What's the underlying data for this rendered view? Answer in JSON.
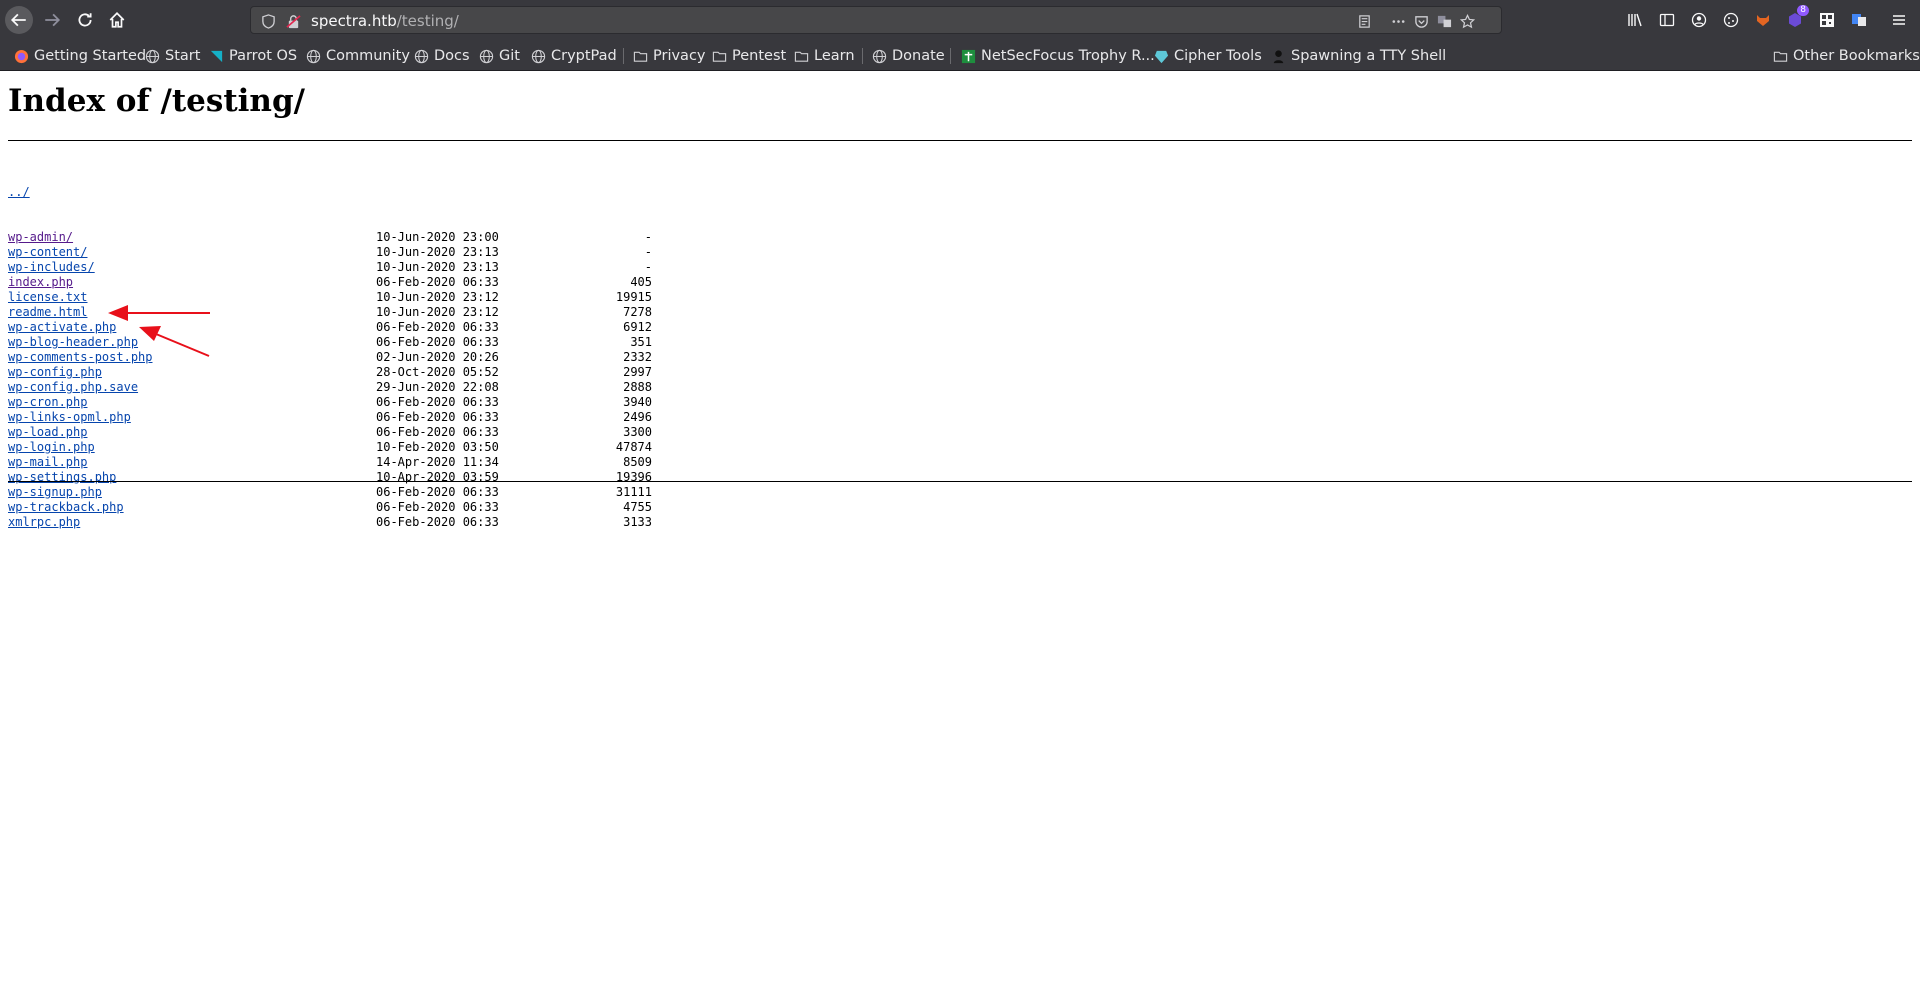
{
  "browser": {
    "url_host": "spectra.htb",
    "url_path": "/testing/",
    "bookmarks": [
      {
        "label": "Getting Started",
        "icon": "firefox-icon"
      },
      {
        "label": "Start",
        "icon": "globe-icon"
      },
      {
        "label": "Parrot OS",
        "icon": "parrot-icon"
      },
      {
        "label": "Community",
        "icon": "globe-icon"
      },
      {
        "label": "Docs",
        "icon": "globe-icon"
      },
      {
        "label": "Git",
        "icon": "globe-icon"
      },
      {
        "label": "CryptPad",
        "icon": "globe-icon"
      },
      {
        "label": "Privacy",
        "icon": "folder-icon"
      },
      {
        "label": "Pentest",
        "icon": "folder-icon"
      },
      {
        "label": "Learn",
        "icon": "folder-icon"
      },
      {
        "label": "Donate",
        "icon": "globe-icon"
      },
      {
        "label": "NetSecFocus Trophy R...",
        "icon": "netsec-icon"
      },
      {
        "label": "Cipher Tools",
        "icon": "cipher-icon"
      },
      {
        "label": "Spawning a TTY Shell",
        "icon": "shell-icon"
      }
    ],
    "other_bookmarks": "Other Bookmarks",
    "extension_badge": "8"
  },
  "page": {
    "title": "Index of /testing/",
    "parent_link": "../",
    "entries": [
      {
        "name": "wp-admin/",
        "date": "10-Jun-2020 23:00",
        "size": "-",
        "visited": true
      },
      {
        "name": "wp-content/",
        "date": "10-Jun-2020 23:13",
        "size": "-",
        "visited": false
      },
      {
        "name": "wp-includes/",
        "date": "10-Jun-2020 23:13",
        "size": "-",
        "visited": false
      },
      {
        "name": "index.php",
        "date": "06-Feb-2020 06:33",
        "size": "405",
        "visited": true
      },
      {
        "name": "license.txt",
        "date": "10-Jun-2020 23:12",
        "size": "19915",
        "visited": false
      },
      {
        "name": "readme.html",
        "date": "10-Jun-2020 23:12",
        "size": "7278",
        "visited": false
      },
      {
        "name": "wp-activate.php",
        "date": "06-Feb-2020 06:33",
        "size": "6912",
        "visited": false
      },
      {
        "name": "wp-blog-header.php",
        "date": "06-Feb-2020 06:33",
        "size": "351",
        "visited": false
      },
      {
        "name": "wp-comments-post.php",
        "date": "02-Jun-2020 20:26",
        "size": "2332",
        "visited": false
      },
      {
        "name": "wp-config.php",
        "date": "28-Oct-2020 05:52",
        "size": "2997",
        "visited": false
      },
      {
        "name": "wp-config.php.save",
        "date": "29-Jun-2020 22:08",
        "size": "2888",
        "visited": false
      },
      {
        "name": "wp-cron.php",
        "date": "06-Feb-2020 06:33",
        "size": "3940",
        "visited": false
      },
      {
        "name": "wp-links-opml.php",
        "date": "06-Feb-2020 06:33",
        "size": "2496",
        "visited": false
      },
      {
        "name": "wp-load.php",
        "date": "06-Feb-2020 06:33",
        "size": "3300",
        "visited": false
      },
      {
        "name": "wp-login.php",
        "date": "10-Feb-2020 03:50",
        "size": "47874",
        "visited": false
      },
      {
        "name": "wp-mail.php",
        "date": "14-Apr-2020 11:34",
        "size": "8509",
        "visited": false
      },
      {
        "name": "wp-settings.php",
        "date": "10-Apr-2020 03:59",
        "size": "19396",
        "visited": false
      },
      {
        "name": "wp-signup.php",
        "date": "06-Feb-2020 06:33",
        "size": "31111",
        "visited": false
      },
      {
        "name": "wp-trackback.php",
        "date": "06-Feb-2020 06:33",
        "size": "4755",
        "visited": false
      },
      {
        "name": "xmlrpc.php",
        "date": "06-Feb-2020 06:33",
        "size": "3133",
        "visited": false
      }
    ]
  },
  "colors": {
    "toolbar": "#38383d",
    "link": "#0645ad",
    "visited": "#551a8b",
    "annotation_arrow": "#e8101a"
  }
}
